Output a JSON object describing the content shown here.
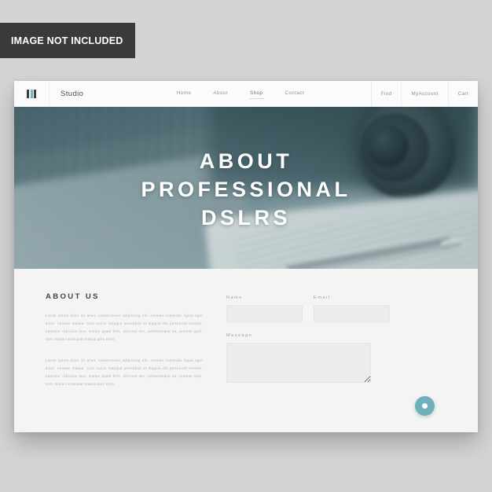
{
  "watermark": {
    "label": "IMAGE NOT INCLUDED"
  },
  "colors": {
    "accent": "#6fb0bc",
    "logo_accent": "#74b3bd",
    "watermark_bg": "#3a3a3a",
    "page_bg": "#d4d4d4",
    "content_bg": "#f4f4f4",
    "navbar_bg": "#fbfbfb",
    "input_bg": "#ececec",
    "heading_text": "#3e4246",
    "body_text": "#a9aeb1"
  },
  "navbar": {
    "logo_icon": "three-bars-logo-icon",
    "brand": "Studio",
    "center_links": [
      {
        "label": "Home",
        "active": false
      },
      {
        "label": "About",
        "active": false
      },
      {
        "label": "Shop",
        "active": true
      },
      {
        "label": "Contact",
        "active": false
      }
    ],
    "right_links": [
      {
        "label": "Find"
      },
      {
        "label": "MyAccount"
      },
      {
        "label": "Cart"
      }
    ]
  },
  "hero": {
    "title_lines": [
      "ABOUT",
      "PROFESSIONAL",
      "DSLRS"
    ],
    "photo_description": "blurred desk photo with laptop keyboard, DSLR camera lens, open notebook and pen"
  },
  "about": {
    "title": "ABOUT US",
    "paragraphs": [
      "Lorem ipsum dolor sit amet, consectetuer adipiscing elit. Aenean commodo ligula eget dolor. Aenean massa. Cum sociis natoque penatibus et magnis dis parturient montes, nascetur ridiculus mus. Donec quam felis, ultricies nec, pellentesque eu, pretium quis, sem. Nulla consequat massa quis enim.",
      "Lorem ipsum dolor sit amet, consectetuer adipiscing elit. Aenean commodo ligula eget dolor. Aenean massa. Cum sociis natoque penatibus et magnis dis parturient montes, nascetur ridiculus mus. Donec quam felis, ultricies nec, pellentesque eu, pretium quis, sem. Nulla consequat massa quis enim."
    ]
  },
  "form": {
    "name_label": "Name",
    "name_value": "",
    "name_placeholder": "",
    "email_label": "Email",
    "email_value": "",
    "email_placeholder": "",
    "message_label": "Message",
    "message_value": "",
    "message_placeholder": "",
    "submit_icon": "circle-dot-submit-icon"
  }
}
